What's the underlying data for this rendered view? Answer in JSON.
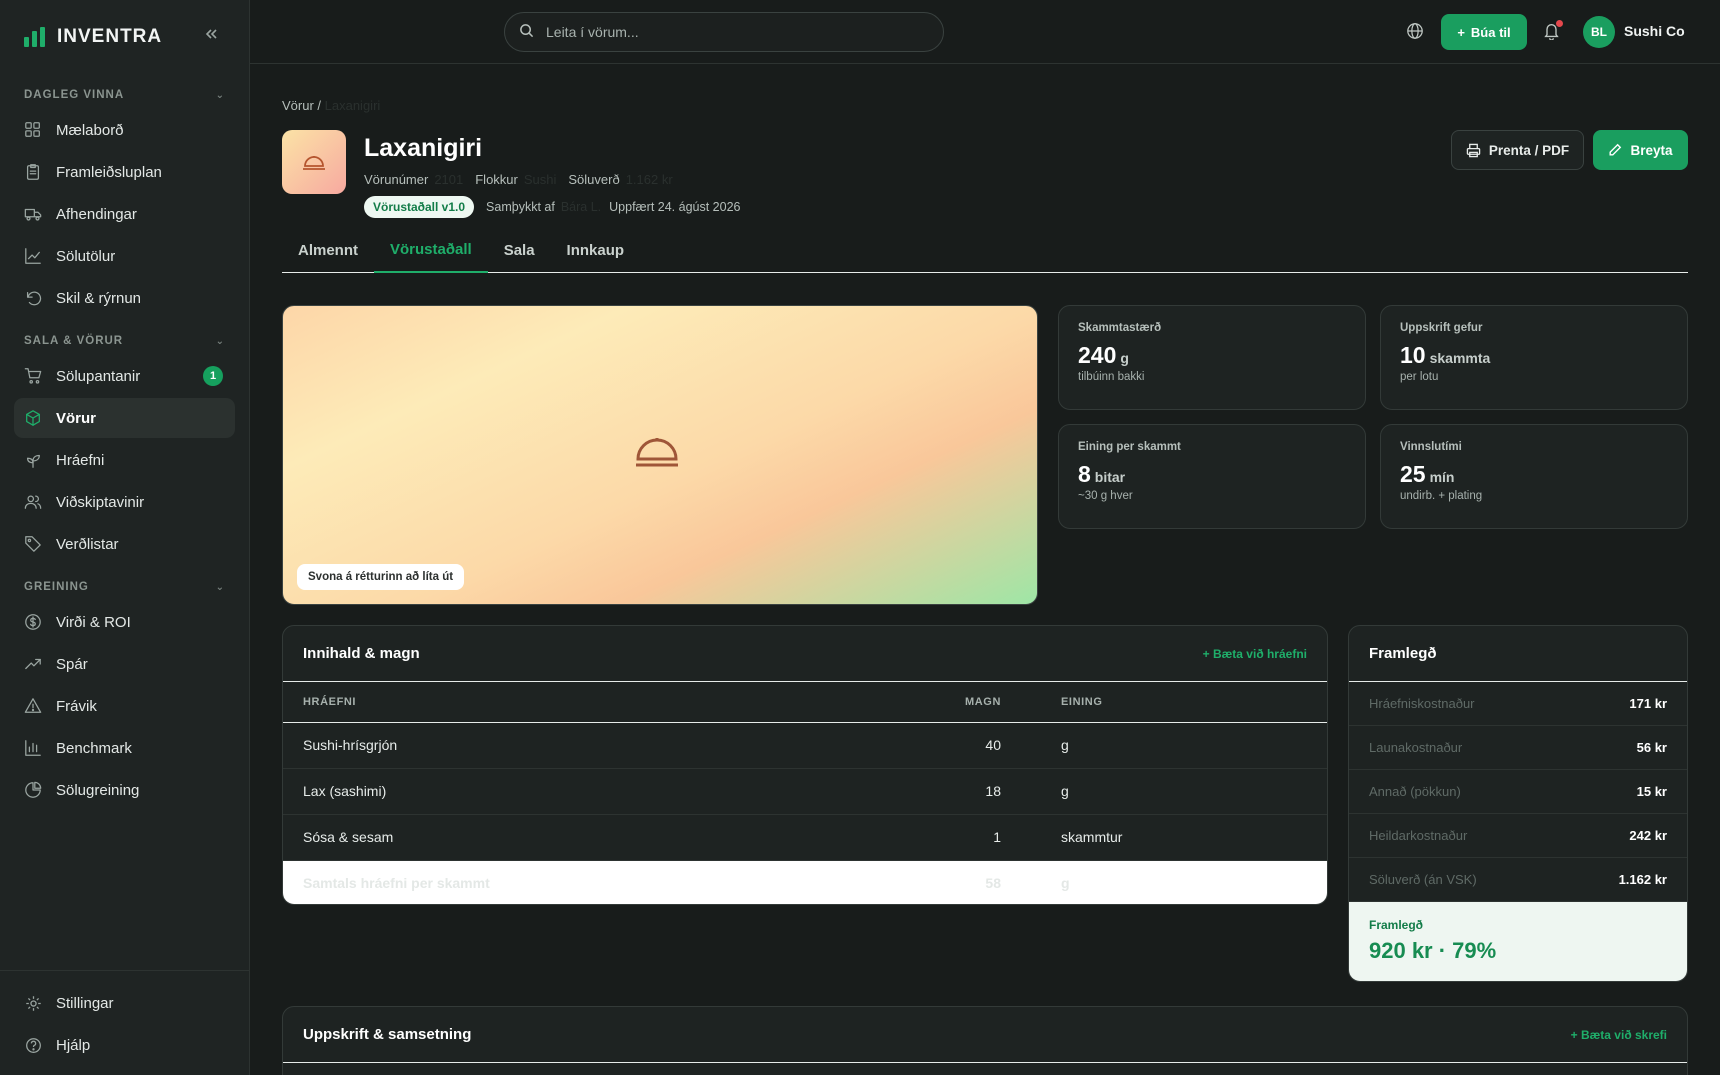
{
  "brand": {
    "name": "INVENTRA"
  },
  "sidebar": {
    "sections": [
      {
        "title": "DAGLEG VINNA",
        "items": [
          {
            "label": "Mælaborð",
            "icon": "dashboard-icon"
          },
          {
            "label": "Framleiðsluplan",
            "icon": "clipboard-icon"
          },
          {
            "label": "Afhendingar",
            "icon": "truck-icon"
          },
          {
            "label": "Sölutölur",
            "icon": "line-chart-icon"
          },
          {
            "label": "Skil & rýrnun",
            "icon": "undo-icon"
          }
        ]
      },
      {
        "title": "SALA & VÖRUR",
        "items": [
          {
            "label": "Sölupantanir",
            "icon": "cart-icon",
            "badge": "1"
          },
          {
            "label": "Vörur",
            "icon": "box-icon",
            "active": true
          },
          {
            "label": "Hráefni",
            "icon": "sprout-icon"
          },
          {
            "label": "Viðskiptavinir",
            "icon": "users-icon"
          },
          {
            "label": "Verðlistar",
            "icon": "tag-icon"
          }
        ]
      },
      {
        "title": "GREINING",
        "items": [
          {
            "label": "Virði & ROI",
            "icon": "dollar-icon"
          },
          {
            "label": "Spár",
            "icon": "trend-icon"
          },
          {
            "label": "Frávik",
            "icon": "warning-icon"
          },
          {
            "label": "Benchmark",
            "icon": "bar-chart-icon"
          },
          {
            "label": "Sölugreining",
            "icon": "pie-chart-icon"
          }
        ]
      }
    ],
    "bottom": [
      {
        "label": "Stillingar",
        "icon": "gear-icon"
      },
      {
        "label": "Hjálp",
        "icon": "help-icon"
      }
    ]
  },
  "topbar": {
    "search_placeholder": "Leita í vörum...",
    "create_label": "Búa til",
    "user_initials": "BL",
    "user_name": "Sushi Co"
  },
  "breadcrumb": {
    "root": "Vörur /",
    "current": "Laxanigiri"
  },
  "product": {
    "name": "Laxanigiri",
    "meta": [
      {
        "label": "Vörunúmer",
        "value": "2101"
      },
      {
        "label": "Flokkur",
        "value": "Sushi"
      },
      {
        "label": "Söluverð",
        "value": "1.162 kr"
      }
    ],
    "status": "Vörustaðall v1.0",
    "approved_label": "Samþykkt af",
    "approved_by": "Bára L.",
    "updated": "Uppfært 24. ágúst 2026"
  },
  "actions": {
    "print": "Prenta / PDF",
    "edit": "Breyta"
  },
  "tabs": [
    {
      "label": "Almennt"
    },
    {
      "label": "Vörustaðall",
      "active": true
    },
    {
      "label": "Sala"
    },
    {
      "label": "Innkaup"
    }
  ],
  "hero": {
    "caption": "Svona á rétturinn að líta út"
  },
  "stats": [
    {
      "label": "Skammtastærð",
      "value": "240",
      "unit": "g",
      "sub": "tilbúinn bakki"
    },
    {
      "label": "Uppskrift gefur",
      "value": "10",
      "unit": "skammta",
      "sub": "per lotu"
    },
    {
      "label": "Eining per skammt",
      "value": "8",
      "unit": "bitar",
      "sub": "~30 g hver"
    },
    {
      "label": "Vinnslutími",
      "value": "25",
      "unit": "mín",
      "sub": "undirb. + plating"
    }
  ],
  "ingredients": {
    "title": "Innihald & magn",
    "add_label": "+ Bæta við hráefni",
    "columns": [
      "HRÁEFNI",
      "MAGN",
      "EINING"
    ],
    "rows": [
      [
        "Sushi-hrísgrjón",
        "40",
        "g"
      ],
      [
        "Lax (sashimi)",
        "18",
        "g"
      ],
      [
        "Sósa & sesam",
        "1",
        "skammtur"
      ]
    ],
    "total": [
      "Samtals hráefni per skammt",
      "58",
      "g"
    ]
  },
  "margin": {
    "title": "Framlegð",
    "rows": [
      {
        "label": "Hráefniskostnaður",
        "value": "171 kr"
      },
      {
        "label": "Launakostnaður",
        "value": "56 kr"
      },
      {
        "label": "Annað (pökkun)",
        "value": "15 kr"
      },
      {
        "label": "Heildarkostnaður",
        "value": "242 kr"
      },
      {
        "label": "Söluverð (án VSK)",
        "value": "1.162 kr"
      }
    ],
    "footer_label": "Framlegð",
    "footer_value": "920 kr · 79%"
  },
  "recipe": {
    "title": "Uppskrift & samsetning",
    "add_label": "+ Bæta við skrefi"
  },
  "colors": {
    "accent": "#1fae6a",
    "sidebar_bg": "#1f2423",
    "page_bg": "#181c1b"
  }
}
